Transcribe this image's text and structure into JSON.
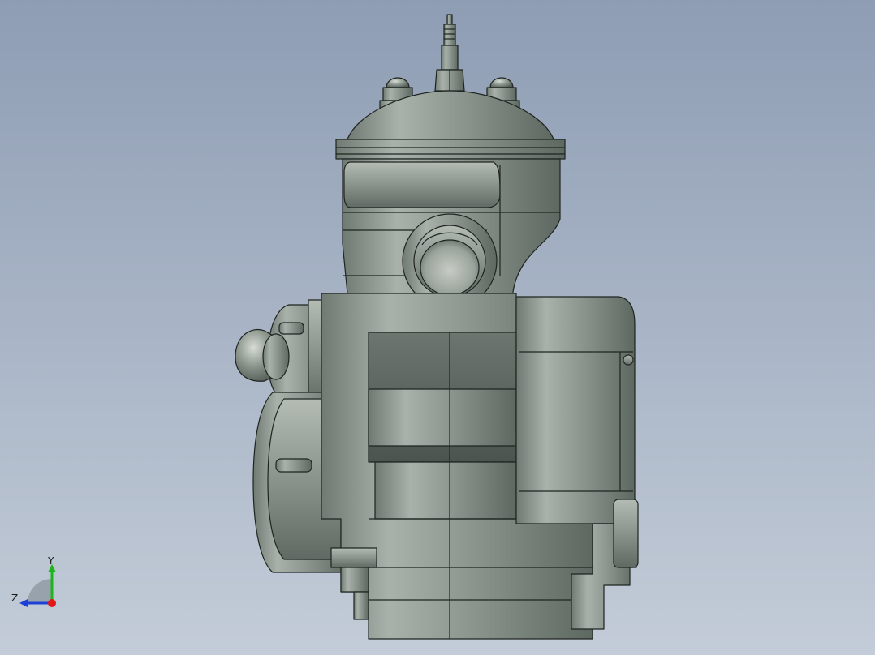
{
  "viewport": {
    "background_top": "#8e9db4",
    "background_bottom": "#c3ccd8",
    "model_color": "#8f9990",
    "model_edge_color": "#1f2420"
  },
  "triad": {
    "y_label": "Y",
    "z_label": "Z",
    "y_axis_color": "#1cb51c",
    "z_axis_color": "#1e3fd6",
    "x_origin_color": "#e01818"
  }
}
